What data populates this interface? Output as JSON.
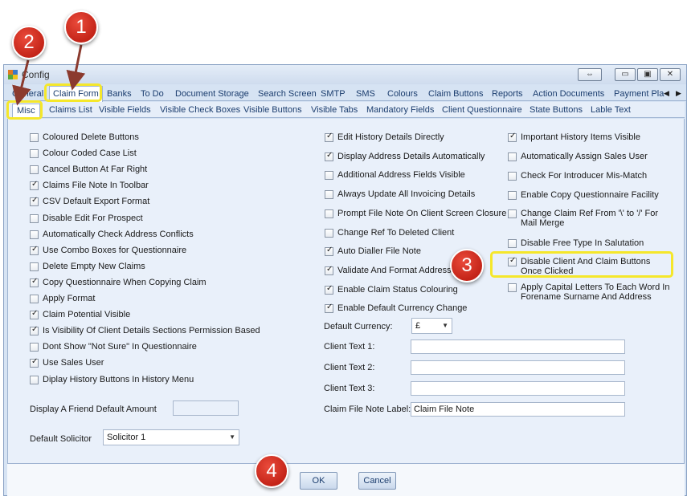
{
  "window": {
    "title": "Config"
  },
  "title_controls": {
    "restore": "⇔",
    "minimize": "▭",
    "maximize": "▣",
    "close": "✕"
  },
  "tabs_main": [
    "General",
    "Claim Form",
    "Banks",
    "To Do",
    "Document Storage",
    "Search Screen",
    "SMTP",
    "SMS",
    "Colours",
    "Claim Buttons",
    "Reports",
    "Action Documents",
    "Payment Pla"
  ],
  "tabs_main_active": "Claim Form",
  "tabs_sub": [
    "Misc",
    "Claims List",
    "Visible Fields",
    "Visible Check Boxes",
    "Visible Buttons",
    "Visible Tabs",
    "Mandatory Fields",
    "Client Questionnaire",
    "State Buttons",
    "Lable Text"
  ],
  "tabs_sub_active": "Misc",
  "col1": [
    {
      "label": "Coloured Delete Buttons",
      "checked": false
    },
    {
      "label": "Colour Coded Case List",
      "checked": false
    },
    {
      "label": "Cancel Button At Far Right",
      "checked": false
    },
    {
      "label": "Claims File Note In Toolbar",
      "checked": true
    },
    {
      "label": "CSV Default Export Format",
      "checked": true
    },
    {
      "label": "Disable Edit For Prospect",
      "checked": false
    },
    {
      "label": "Automatically Check Address Conflicts",
      "checked": false
    },
    {
      "label": "Use Combo Boxes for Questionnaire",
      "checked": true
    },
    {
      "label": "Delete Empty New Claims",
      "checked": false
    },
    {
      "label": "Copy Questionnaire When Copying Claim",
      "checked": true
    },
    {
      "label": "Apply Format",
      "checked": false
    },
    {
      "label": "Claim Potential Visible",
      "checked": true
    },
    {
      "label": "Is Visibility Of Client Details Sections Permission Based",
      "checked": true
    },
    {
      "label": "Dont Show \"Not Sure\" In Questionnaire",
      "checked": false
    },
    {
      "label": "Use Sales User",
      "checked": true
    },
    {
      "label": "Diplay History Buttons In History Menu",
      "checked": false
    }
  ],
  "col2": [
    {
      "label": "Edit History Details Directly",
      "checked": true
    },
    {
      "label": "Display Address Details Automatically",
      "checked": true
    },
    {
      "label": "Additional Address Fields Visible",
      "checked": false
    },
    {
      "label": "Always Update All Invoicing Details",
      "checked": false
    },
    {
      "label": "Prompt File Note On Client Screen Closure",
      "checked": false
    },
    {
      "label": "Change Ref To Deleted Client",
      "checked": false
    },
    {
      "label": "Auto Dialler File Note",
      "checked": true
    },
    {
      "label": "Validate And Format Address",
      "checked": true
    },
    {
      "label": "Enable Claim Status Colouring",
      "checked": true
    },
    {
      "label": "Enable Default Currency Change",
      "checked": true
    }
  ],
  "col3": [
    {
      "label": "Important History Items Visible",
      "checked": true
    },
    {
      "label": "Automatically Assign Sales User",
      "checked": false
    },
    {
      "label": "Check For Introducer Mis-Match",
      "checked": false
    },
    {
      "label": "Enable Copy Questionnaire Facility",
      "checked": false
    },
    {
      "label": "Change Claim Ref  From '\\' to '/' For Mail Merge",
      "checked": false
    },
    {
      "label": "Disable Free Type In Salutation",
      "checked": false
    },
    {
      "label": "Disable Client And Claim Buttons Once Clicked",
      "checked": true
    },
    {
      "label": "Apply Capital Letters To Each Word In Forename Surname And Address",
      "checked": false
    }
  ],
  "fields": {
    "display_friend_label": "Display A Friend Default Amount",
    "display_friend_value": "",
    "default_solicitor_label": "Default Solicitor",
    "default_solicitor_value": "Solicitor 1",
    "default_currency_label": "Default Currency:",
    "default_currency_value": "£",
    "client_text1_label": "Client Text 1:",
    "client_text1_value": "",
    "client_text2_label": "Client Text 2:",
    "client_text2_value": "",
    "client_text3_label": "Client Text 3:",
    "client_text3_value": "",
    "claim_file_note_label": "Claim File Note Label:",
    "claim_file_note_value": "Claim File Note"
  },
  "buttons": {
    "ok": "OK",
    "cancel": "Cancel"
  },
  "callouts": [
    "1",
    "2",
    "3",
    "4"
  ],
  "colors": {
    "callout": "#d8352a",
    "highlight": "#f5e72a",
    "window_bg": "#d6e3f3",
    "panel_bg": "#e9f0fa"
  }
}
